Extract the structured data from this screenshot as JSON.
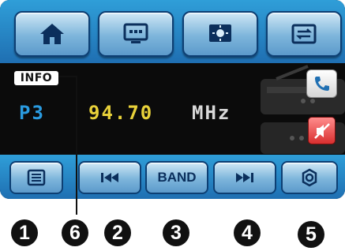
{
  "top_toolbar": {
    "buttons": [
      {
        "icon": "home-icon"
      },
      {
        "icon": "display-icon"
      },
      {
        "icon": "brightness-icon"
      },
      {
        "icon": "swap-source-icon"
      }
    ]
  },
  "display": {
    "info_label": "INFO",
    "station": "P3",
    "frequency": "94.70",
    "unit": "MHz"
  },
  "side_buttons": {
    "phone_icon": "phone-icon",
    "mute_icon": "mute-icon"
  },
  "bottom_toolbar": {
    "list_icon": "list-icon",
    "prev_icon": "skip-previous-icon",
    "band_label": "BAND",
    "next_icon": "skip-next-icon",
    "settings_icon": "settings-icon"
  },
  "callouts": {
    "c1": "1",
    "c2": "2",
    "c3": "3",
    "c4": "4",
    "c5": "5",
    "c6": "6"
  },
  "colors": {
    "toolbar_blue": "#1f6fb2",
    "station_blue": "#2a9be0",
    "frequency_yellow": "#e8d13a",
    "mute_red": "#d92f2f"
  }
}
